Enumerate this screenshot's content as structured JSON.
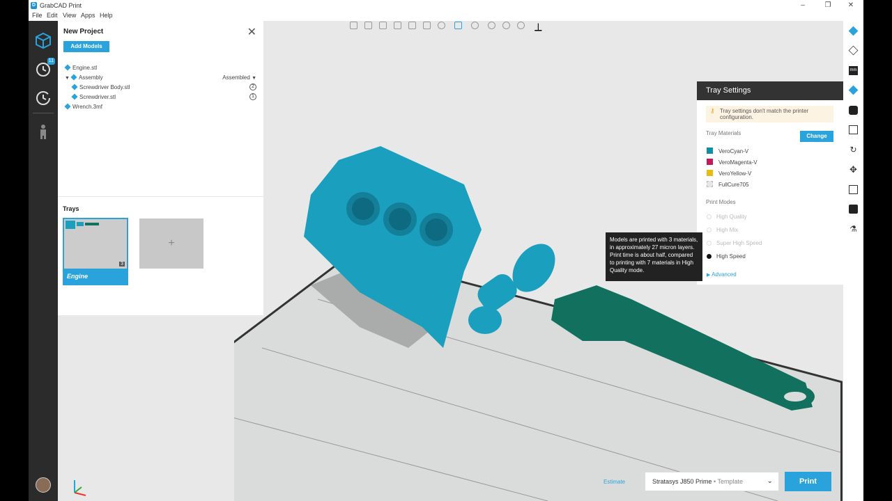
{
  "window": {
    "title": "GrabCAD Print"
  },
  "menu": [
    "File",
    "Edit",
    "View",
    "Apps",
    "Help"
  ],
  "rail": {
    "badge": "11"
  },
  "project": {
    "title": "New Project",
    "add_models": "Add Models",
    "items": [
      {
        "name": "Engine.stl"
      },
      {
        "name": "Assembly",
        "mode": "Assembled"
      },
      {
        "name": "Screwdriver Body.stl",
        "count": "2"
      },
      {
        "name": "Screwdriver.stl",
        "count": "1"
      },
      {
        "name": "Wrench.3mf"
      }
    ],
    "trays_label": "Trays",
    "tray": {
      "name": "Engine",
      "count": "3"
    },
    "tray_add": "+"
  },
  "tray_settings": {
    "title": "Tray Settings",
    "warning": "Tray settings don't match the printer configuration.",
    "materials_label": "Tray Materials",
    "change": "Change",
    "materials": [
      {
        "name": "VeroCyan-V",
        "color": "#0e8fa6"
      },
      {
        "name": "VeroMagenta-V",
        "color": "#c21a5a"
      },
      {
        "name": "VeroYellow-V",
        "color": "#e8bd12"
      },
      {
        "name": "FullCure705",
        "color": "#e6e6e6"
      }
    ],
    "modes_label": "Print Modes",
    "modes": [
      "High Quality",
      "High Mix",
      "Super High Speed",
      "High Speed"
    ],
    "selected_mode": "High Speed",
    "advanced": "Advanced",
    "tooltip": "Models are printed with 3 materials, in approximately 27 micron layers. Print time is about half, compared to printing with 7 materials in High Quality mode."
  },
  "bottom": {
    "estimate": "Estimate",
    "printer": "Stratasys J850 Prime",
    "template": "Template",
    "print": "Print"
  },
  "colors": {
    "accent": "#2aa3dc",
    "model_cyan": "#1a9fbf",
    "model_green": "#12715e"
  }
}
